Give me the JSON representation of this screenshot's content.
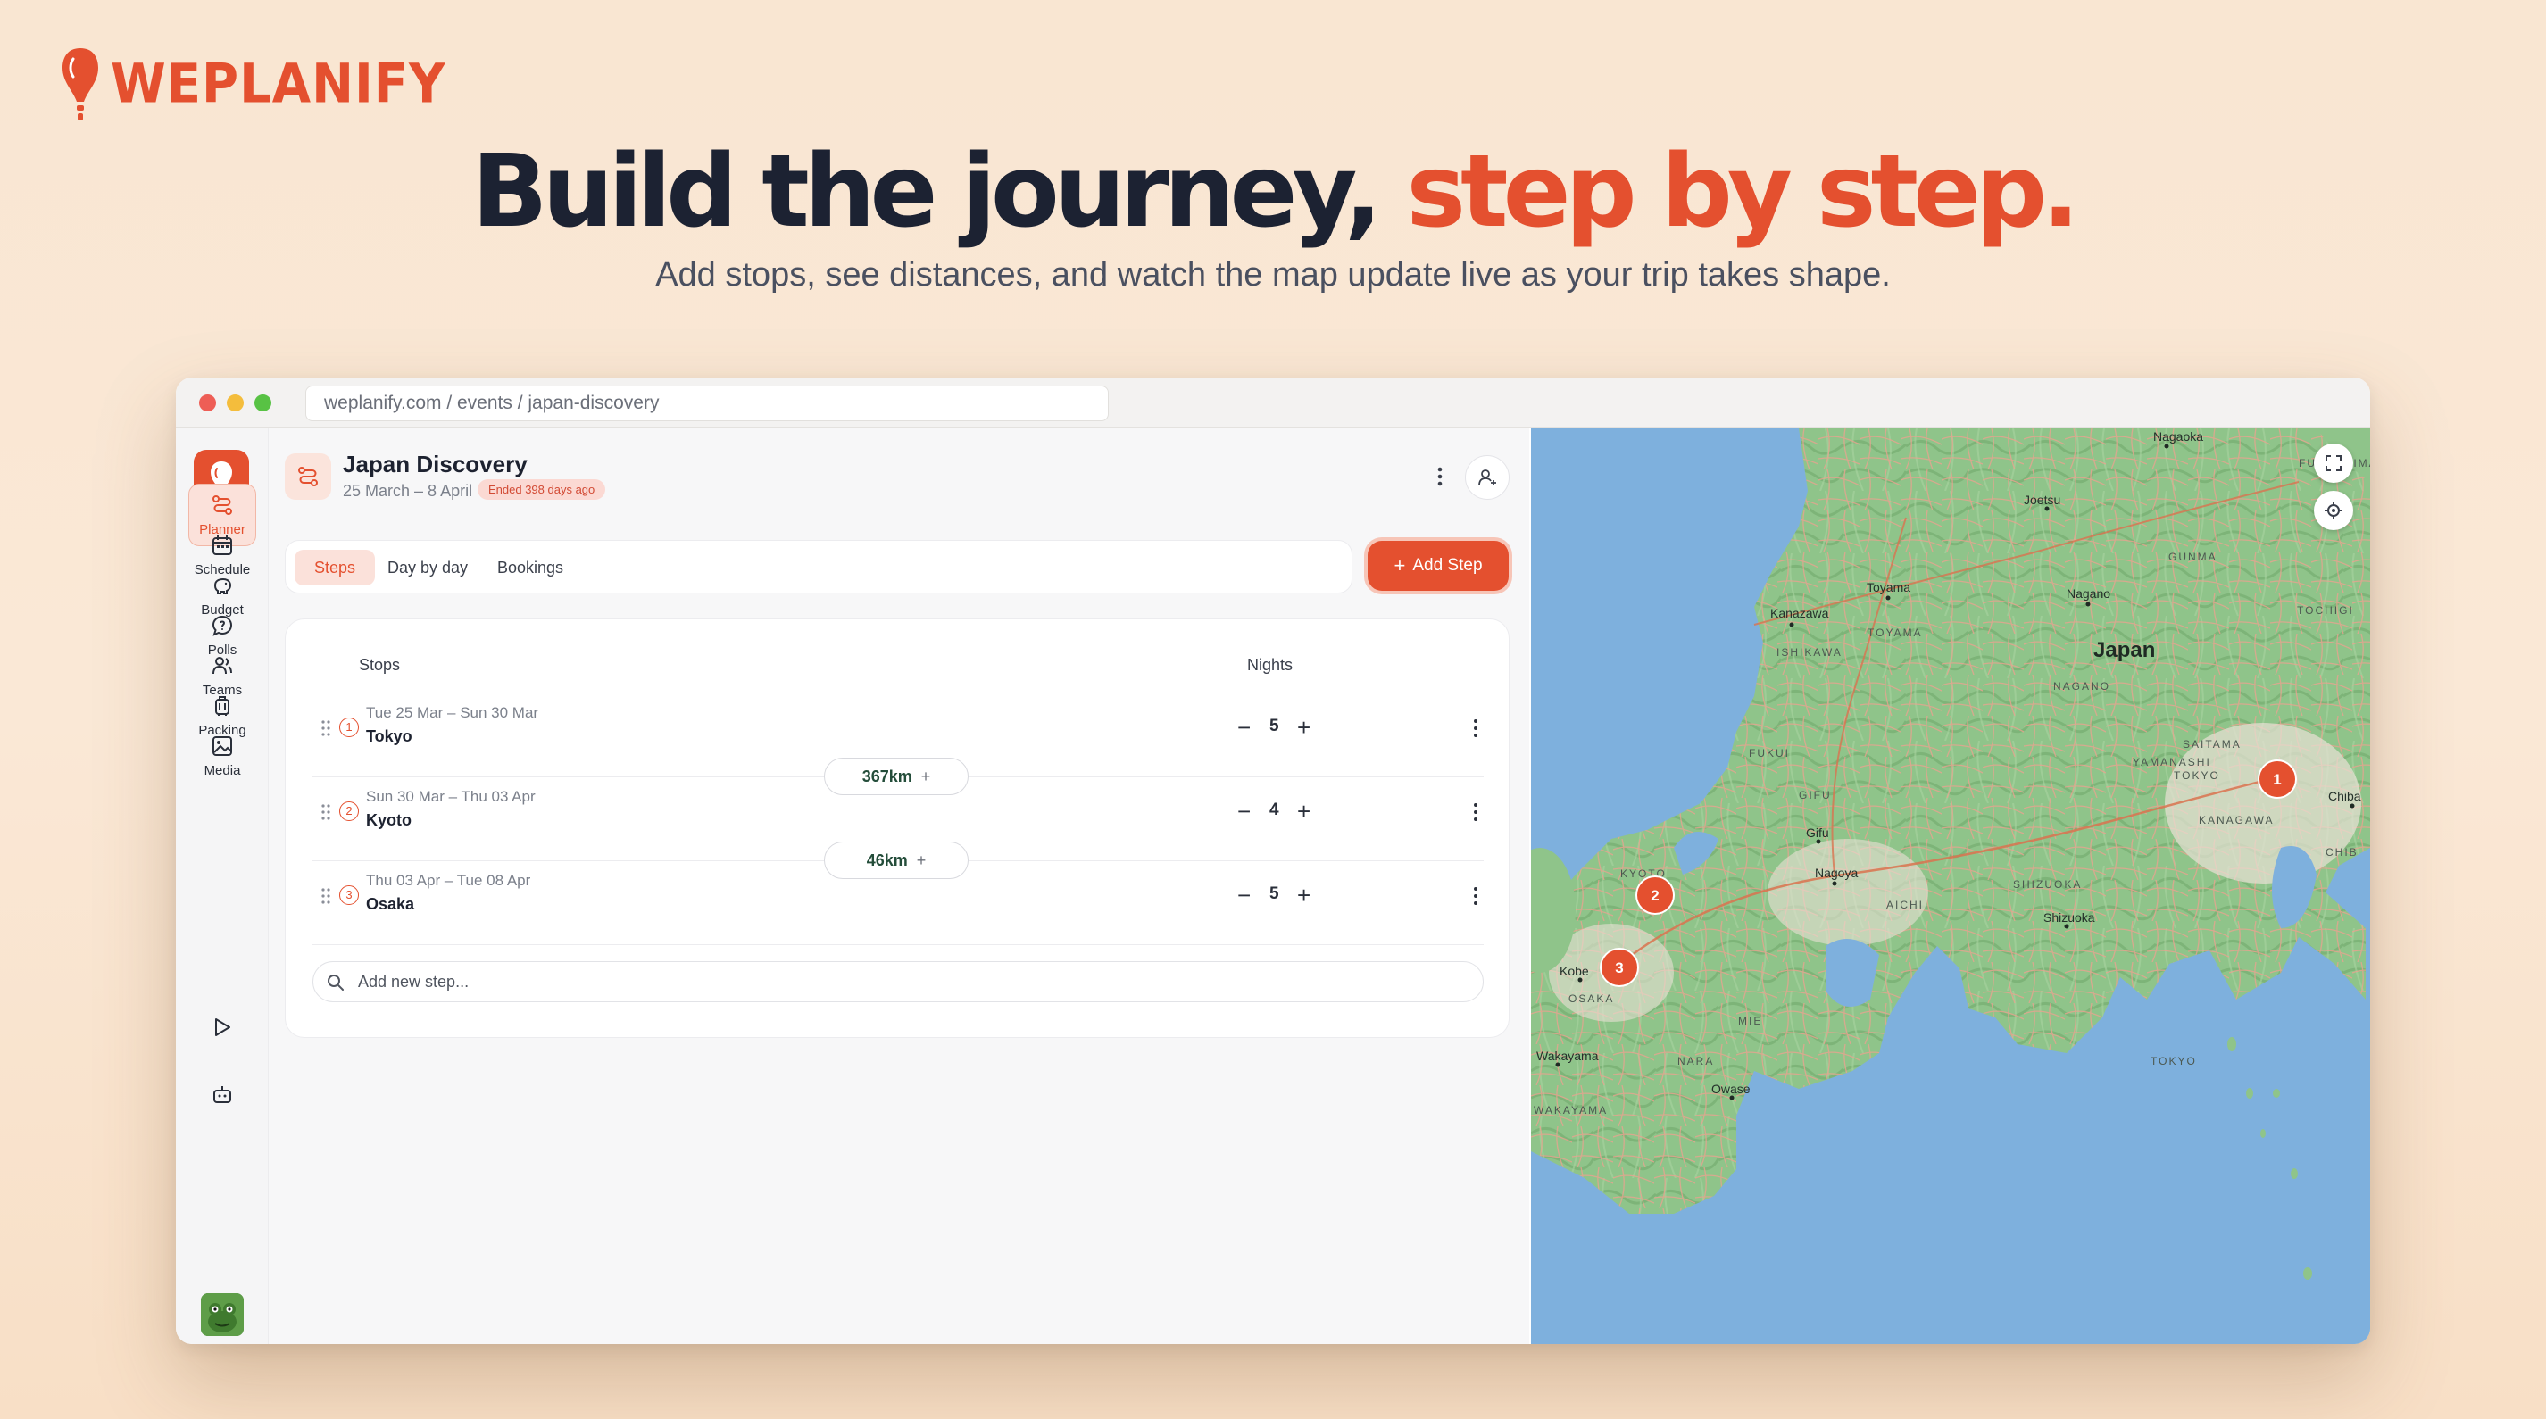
{
  "brand": {
    "name": "WEPLANIFY",
    "color": "#e4502f"
  },
  "hero": {
    "title_main": "Build the journey, ",
    "title_accent": "step by step.",
    "subtitle": "Add stops, see distances, and watch the map update live as your trip takes shape."
  },
  "browser": {
    "url": "weplanify.com / events / japan-discovery"
  },
  "sidebar": {
    "items": [
      {
        "label": "Planner",
        "icon": "route-icon",
        "active": true
      },
      {
        "label": "Schedule",
        "icon": "calendar-icon"
      },
      {
        "label": "Budget",
        "icon": "piggy-bank-icon"
      },
      {
        "label": "Polls",
        "icon": "poll-icon"
      },
      {
        "label": "Teams",
        "icon": "users-icon"
      },
      {
        "label": "Packing",
        "icon": "luggage-icon"
      },
      {
        "label": "Media",
        "icon": "image-icon"
      }
    ],
    "bottom": [
      "play-icon",
      "bot-icon",
      "avatar"
    ]
  },
  "event": {
    "title": "Japan Discovery",
    "dates": "25 March – 8 April",
    "status": "Ended 398 days ago"
  },
  "tabs": [
    {
      "label": "Steps",
      "active": true
    },
    {
      "label": "Day by day"
    },
    {
      "label": "Bookings"
    }
  ],
  "add_step_label": "Add Step",
  "table": {
    "col_stops": "Stops",
    "col_nights": "Nights",
    "steps": [
      {
        "num": "1",
        "dates": "Tue 25 Mar – Sun 30 Mar",
        "city": "Tokyo",
        "nights": "5"
      },
      {
        "num": "2",
        "dates": "Sun 30 Mar – Thu 03 Apr",
        "city": "Kyoto",
        "nights": "4"
      },
      {
        "num": "3",
        "dates": "Thu 03 Apr – Tue 08 Apr",
        "city": "Osaka",
        "nights": "5"
      }
    ],
    "distances": [
      "367km",
      "46km"
    ],
    "minus_glyph": "−",
    "plus_glyph": "+"
  },
  "add_new_placeholder": "Add new step...",
  "map": {
    "labels": {
      "country": "Japan",
      "cities": [
        "Nagaoka",
        "Joetsu",
        "Toyama",
        "Kanazawa",
        "Nagano",
        "Gifu",
        "Nagoya",
        "Kobe",
        "Wakayama",
        "Shizuoka",
        "Chiba",
        "Owase"
      ],
      "regions": [
        "FUKUSHIMA",
        "GUNMA",
        "TOCHIGI",
        "TOYAMA",
        "ISHIKAWA",
        "NAGANO",
        "FUKUI",
        "YAMANASHI",
        "SAITAMA",
        "TOKYO",
        "GIFU",
        "KANAGAWA",
        "SHIZUOKA",
        "AICHI",
        "KYOTO",
        "OSAKA",
        "MIE",
        "NARA",
        "WAKAYAMA",
        "CHIB"
      ],
      "tokyo_partial": "T"
    },
    "markers": [
      "1",
      "2",
      "3"
    ],
    "colors": {
      "water": "#7fb1dd",
      "land": "#8fc48a",
      "marker": "#e4502f"
    }
  }
}
